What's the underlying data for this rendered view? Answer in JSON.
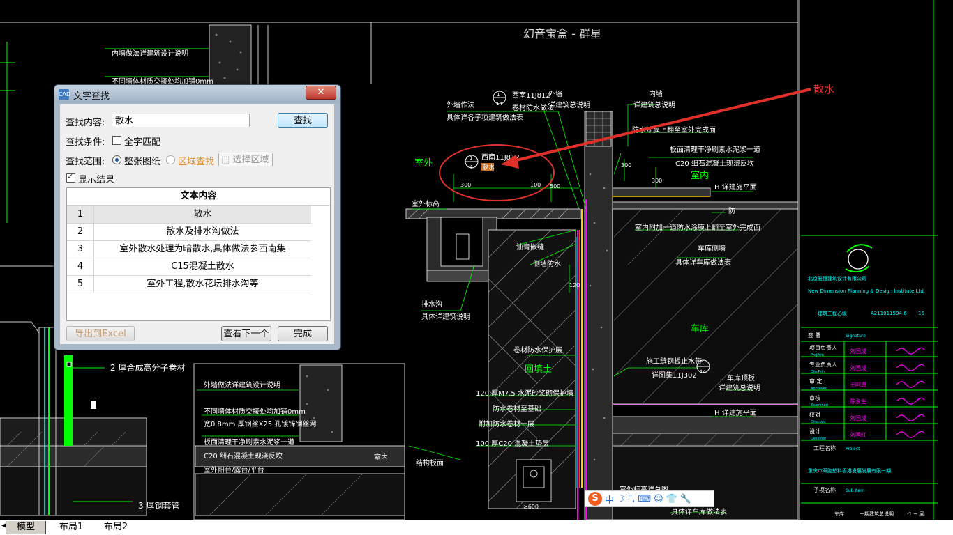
{
  "drawing": {
    "header_title": "幻音宝盒 - 群星",
    "annotation_text": "散水",
    "labels_cn": {
      "outside": "室外",
      "inside": "室内",
      "garage": "车库",
      "backfill": "回填土",
      "wall_note_1": "外墙作法",
      "wall_note_2": "具体详各子项建筑做法表",
      "exterior_wall": "外墙",
      "exterior_wall_2": "详建筑总说明",
      "interior_wall": "内墙",
      "interior_wall_2": "详建筑总说明",
      "waterproof_paint": "防水涂膜上翻至室外完成面",
      "slab_note": "板面清理干净刷素水泥浆一道",
      "slab_note_2": "C20 细石混凝土现浇反坎",
      "level_h1": "H 详建施平面",
      "level_h2": "H 详建施平面",
      "fang": "防",
      "interior_add": "室内附加一道防水涂膜上翻至室外完成面",
      "garage_floor": "车库侧墙",
      "garage_floor_2": "具体详车库做法表",
      "exterior_sill": "室外标高",
      "oil_seal": "油膏嵌缝",
      "side_wall_wp": "侧墙防水",
      "drain_ditch": "排水沟",
      "drain_ditch_2": "具体详建筑说明",
      "roll_wp": "卷材防水保护层",
      "brick_wall": "120 厚M7.5 水泥砂浆砌保护墙",
      "wp_layer": "防水卷材至基础",
      "add_wp": "附加防水卷材一层",
      "c20_cushion": "100 厚C20 混凝土垫层",
      "steel_stop": "施工缝钢板止水带",
      "steel_stop_2": "详图集11J302",
      "garage_roof": "车库顶板",
      "garage_roof_2": "详建筑总说明",
      "west_sec": "西南11J812",
      "sanshui": "散水",
      "roll_mat_note": "2 厚合成高分子卷材",
      "steel_pipe": "3 厚钢套管",
      "ext_wall_note": "外墙做法详建筑设计说明",
      "diff_wall_note": "不同墙体材质交接处均加铺0mm",
      "mesh_note": "宽0.8mm 厚钢丝X25 孔镀锌钢丝网",
      "slab_b": "板面清理干净刷素水泥浆一道",
      "c20_b": "C20 细石混凝土现浇反坎",
      "balcony": "室外阳台/露台/平台",
      "inner_wall_b": "内墙做法详建筑设计说明",
      "diff_wall_b": "不同墙体材质交接处均加铺0mm",
      "struct_slab": "结构板面",
      "room_b": "室内",
      "garage_detail": "具体详车库做法表",
      "garage_edge": "室外标高详总图"
    },
    "dims": [
      "300",
      "100",
      "300",
      "500",
      "120",
      "300",
      "≥600",
      "300"
    ],
    "title_block": {
      "company_cn": "北京雅恒建筑设计有限公司",
      "company_en": "New Dimension Planning & Design Institute Ltd.",
      "cert": "建筑工程乙级",
      "cert_no": "A211011594-6",
      "cert_suffix": "16",
      "sign_header": "签 署",
      "sign_header_en": "Signature",
      "roles": [
        {
          "cn": "项目负责人",
          "en": "ProjPrin",
          "name": "刘国成"
        },
        {
          "cn": "专业负责人",
          "en": "DiscPrin",
          "name": "刘国成"
        },
        {
          "cn": "审 定",
          "en": "Approved",
          "name": "王阿惠"
        },
        {
          "cn": "审核",
          "en": "Examined",
          "name": "陈永生"
        },
        {
          "cn": "校对",
          "en": "Checked",
          "name": "刘国成"
        },
        {
          "cn": "设计",
          "en": "Designer",
          "name": "刘国红"
        }
      ],
      "project_label": "工程名称",
      "project_label_en": "Project",
      "project_name": "重庆市双胞塑料香港发展发展有限一期",
      "item_label": "子项名称",
      "item_label_en": "Sub Item",
      "footer_left": "车库",
      "footer_mid": "一期建筑总说明",
      "footer_right": "-1 ~ 层"
    }
  },
  "dialog": {
    "title": "文字查找",
    "close_label": "✕",
    "search_label": "查找内容:",
    "search_value": "散水",
    "find_button": "查找",
    "condition_label": "查找条件:",
    "whole_word_label": "全字匹配",
    "scope_label": "查找范围:",
    "scope_all": "整张图纸",
    "scope_area": "区域查找",
    "select_area_button": "选择区域",
    "show_results_label": "显示结果",
    "table_header": "文本内容",
    "results": [
      {
        "num": "1",
        "text": "散水"
      },
      {
        "num": "2",
        "text": "散水及排水沟做法"
      },
      {
        "num": "3",
        "text": "室外散水处理为暗散水,具体做法参西南集"
      },
      {
        "num": "4",
        "text": "C15混凝土散水"
      },
      {
        "num": "5",
        "text": "室外工程,散水花坛排水沟等"
      }
    ],
    "export_button": "导出到Excel",
    "next_button": "查看下一个",
    "done_button": "完成"
  },
  "tabs": [
    "模型",
    "布局1",
    "布局2"
  ],
  "ime": {
    "logo": "S",
    "mode": "中"
  },
  "colors": {
    "cad_green": "#00ff00",
    "cad_yellow": "#ffff00",
    "cad_magenta": "#ff00ff",
    "cad_cyan": "#00ffff",
    "annotation_red": "#e0302a"
  }
}
